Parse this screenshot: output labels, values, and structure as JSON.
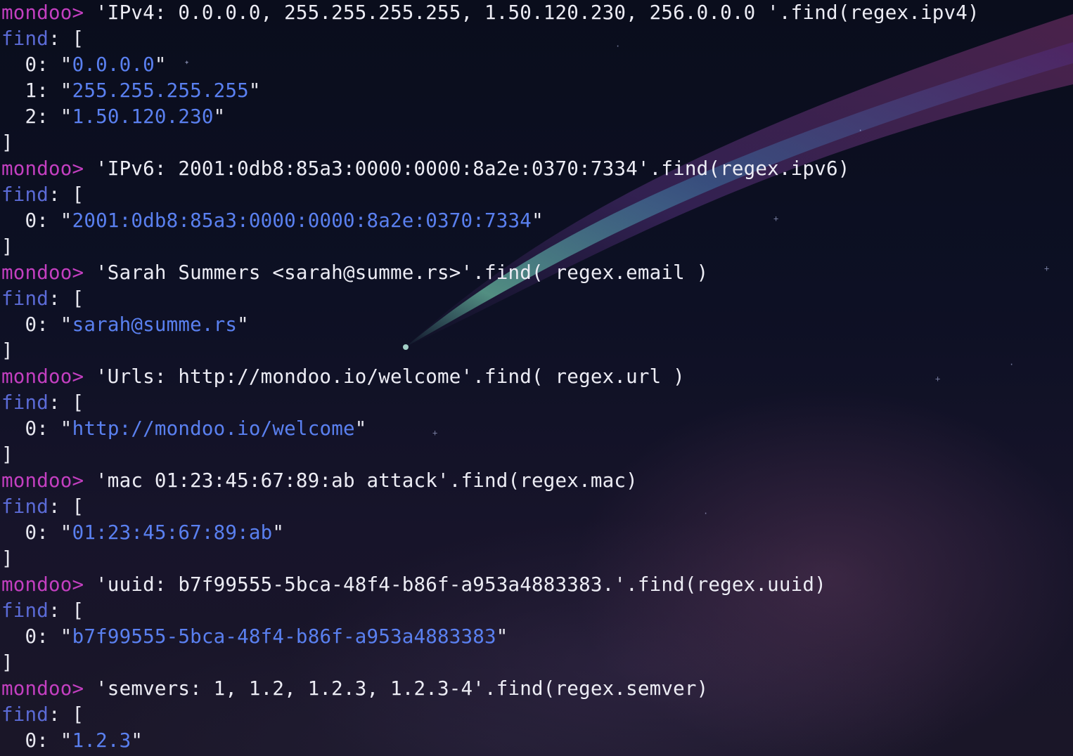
{
  "terminal": {
    "prompt": "mondoo>",
    "sessions": [
      {
        "command": " 'IPv4: 0.0.0.0, 255.255.255.255, 1.50.120.230, 256.0.0.0 '.find(regex.ipv4)",
        "result_label": "find",
        "results": [
          {
            "index": "0",
            "value": "0.0.0.0"
          },
          {
            "index": "1",
            "value": "255.255.255.255"
          },
          {
            "index": "2",
            "value": "1.50.120.230"
          }
        ]
      },
      {
        "command": " 'IPv6: 2001:0db8:85a3:0000:0000:8a2e:0370:7334'.find(regex.ipv6)",
        "result_label": "find",
        "results": [
          {
            "index": "0",
            "value": "2001:0db8:85a3:0000:0000:8a2e:0370:7334"
          }
        ]
      },
      {
        "command": " 'Sarah Summers <sarah@summe.rs>'.find( regex.email )",
        "result_label": "find",
        "results": [
          {
            "index": "0",
            "value": "sarah@summe.rs"
          }
        ]
      },
      {
        "command": " 'Urls: http://mondoo.io/welcome'.find( regex.url )",
        "result_label": "find",
        "results": [
          {
            "index": "0",
            "value": "http://mondoo.io/welcome"
          }
        ]
      },
      {
        "command": " 'mac 01:23:45:67:89:ab attack'.find(regex.mac)",
        "result_label": "find",
        "results": [
          {
            "index": "0",
            "value": "01:23:45:67:89:ab"
          }
        ]
      },
      {
        "command": " 'uuid: b7f99555-5bca-48f4-b86f-a953a4883383.'.find(regex.uuid)",
        "result_label": "find",
        "results": [
          {
            "index": "0",
            "value": "b7f99555-5bca-48f4-b86f-a953a4883383"
          }
        ]
      },
      {
        "command": " 'semvers: 1, 1.2, 1.2.3, 1.2.3-4'.find(regex.semver)",
        "result_label": "find",
        "results": [
          {
            "index": "0",
            "value": "1.2.3"
          }
        ]
      }
    ]
  },
  "colors": {
    "prompt": "#c33fc0",
    "keyword": "#5b6bd6",
    "string": "#5a80f0",
    "text": "#e8e8f0",
    "background": "#0b0d1c"
  },
  "background_icon": "comet-wallpaper"
}
